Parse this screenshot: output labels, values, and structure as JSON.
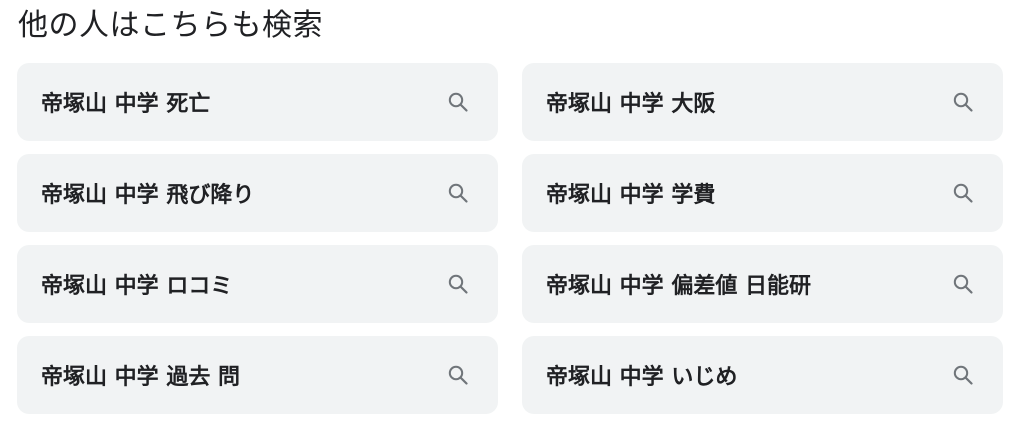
{
  "section": {
    "title": "他の人はこちらも検索"
  },
  "related_searches": [
    {
      "label": "帝塚山 中学 死亡",
      "icon": "search-icon"
    },
    {
      "label": "帝塚山 中学 大阪",
      "icon": "search-icon"
    },
    {
      "label": "帝塚山 中学 飛び降り",
      "icon": "search-icon"
    },
    {
      "label": "帝塚山 中学 学費",
      "icon": "search-icon"
    },
    {
      "label": "帝塚山 中学 ロコミ",
      "icon": "search-icon"
    },
    {
      "label": "帝塚山 中学 偏差値 日能研",
      "icon": "search-icon"
    },
    {
      "label": "帝塚山 中学 過去 問",
      "icon": "search-icon"
    },
    {
      "label": "帝塚山 中学 いじめ",
      "icon": "search-icon"
    }
  ],
  "colors": {
    "chip_background": "#f1f3f4",
    "text": "#202124",
    "icon": "#70757a"
  }
}
